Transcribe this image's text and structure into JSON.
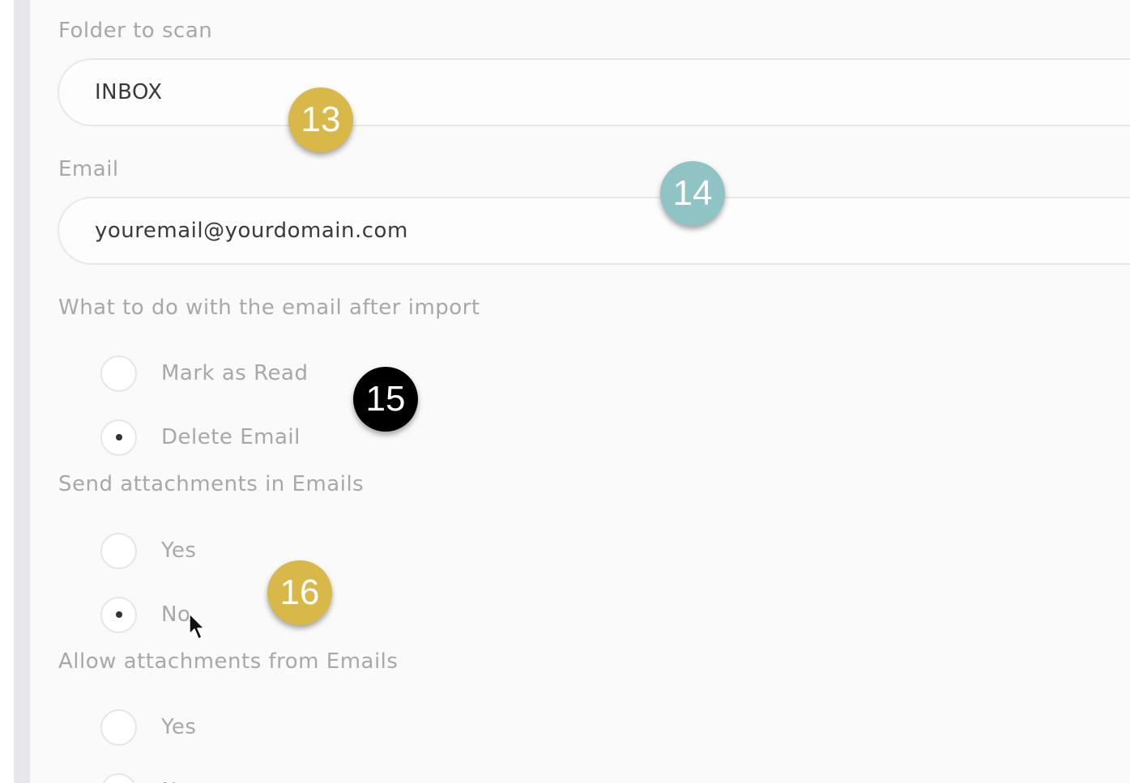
{
  "form": {
    "folder": {
      "label": "Folder to scan",
      "value": "INBOX"
    },
    "email": {
      "label": "Email",
      "value": "youremail@yourdomain.com"
    },
    "after_import": {
      "label": "What to do with the email after import",
      "options": [
        {
          "label": "Mark as Read",
          "selected": false
        },
        {
          "label": "Delete Email",
          "selected": true
        }
      ]
    },
    "send_attachments": {
      "label": "Send attachments in Emails",
      "options": [
        {
          "label": "Yes",
          "selected": false
        },
        {
          "label": "No",
          "selected": true
        }
      ]
    },
    "allow_attachments": {
      "label": "Allow attachments from Emails",
      "options": [
        {
          "label": "Yes",
          "selected": false
        },
        {
          "label": "No",
          "selected": false
        }
      ]
    }
  },
  "markers": [
    {
      "number": "13",
      "color": "#d9b84a"
    },
    {
      "number": "14",
      "color": "#8fc3c4"
    },
    {
      "number": "15",
      "color": "#000000"
    },
    {
      "number": "16",
      "color": "#d9b84a"
    }
  ],
  "cursor": {
    "icon": "mouse-pointer-icon"
  }
}
